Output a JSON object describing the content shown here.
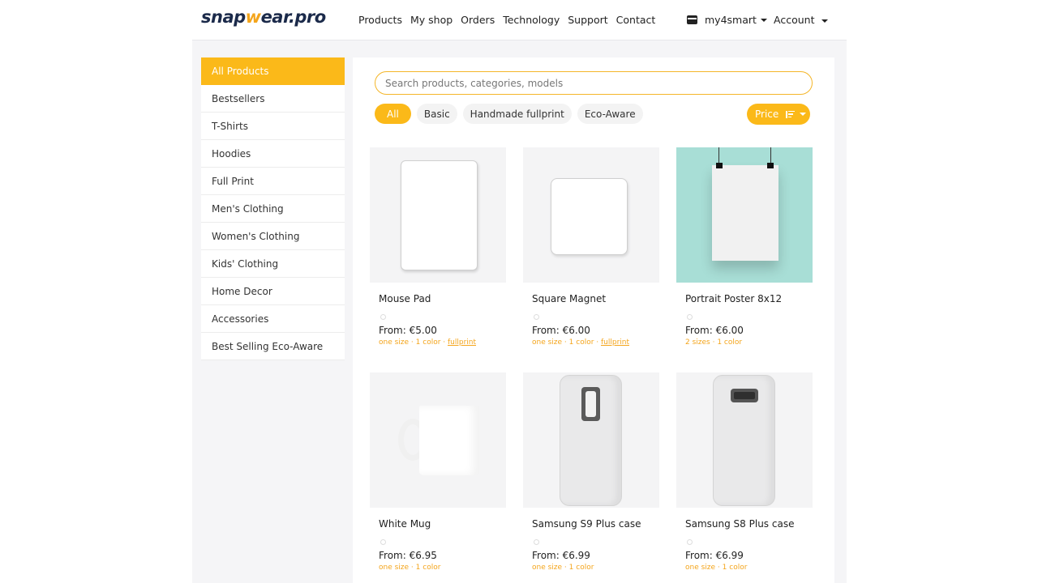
{
  "header": {
    "logo_prefix": "snap",
    "logo_accent": "w",
    "logo_suffix": "ear.pro",
    "nav": [
      "Products",
      "My shop",
      "Orders",
      "Technology",
      "Support",
      "Contact"
    ],
    "shop_name": "my4smart",
    "account_label": "Account"
  },
  "sidebar": {
    "items": [
      {
        "label": "All Products",
        "active": true
      },
      {
        "label": "Bestsellers"
      },
      {
        "label": "T-Shirts"
      },
      {
        "label": "Hoodies"
      },
      {
        "label": "Full Print"
      },
      {
        "label": "Men's Clothing"
      },
      {
        "label": "Women's Clothing"
      },
      {
        "label": "Kids' Clothing"
      },
      {
        "label": "Home Decor"
      },
      {
        "label": "Accessories"
      },
      {
        "label": "Best Selling Eco-Aware"
      }
    ]
  },
  "search": {
    "placeholder": "Search products, categories, models"
  },
  "filters": {
    "chips": [
      "All",
      "Basic",
      "Handmade fullprint",
      "Eco-Aware"
    ],
    "active_chip": "All",
    "sort_label": "Price"
  },
  "products": [
    {
      "name": "Mouse Pad",
      "price": "From: €5.00",
      "sizes": "one size",
      "colors": "1 color",
      "extra": "fullprint",
      "image": "mouse-pad"
    },
    {
      "name": "Square Magnet",
      "price": "From: €6.00",
      "sizes": "one size",
      "colors": "1 color",
      "extra": "fullprint",
      "image": "square-magnet"
    },
    {
      "name": "Portrait Poster 8x12",
      "price": "From: €6.00",
      "sizes": "2 sizes",
      "colors": "1 color",
      "extra": "",
      "image": "poster"
    },
    {
      "name": "White Mug",
      "price": "From: €6.95",
      "sizes": "one size",
      "colors": "1 color",
      "extra": "",
      "image": "mug"
    },
    {
      "name": "Samsung S9 Plus case",
      "price": "From: €6.99",
      "sizes": "one size",
      "colors": "1 color",
      "extra": "",
      "image": "phone-s9"
    },
    {
      "name": "Samsung S8 Plus case",
      "price": "From: €6.99",
      "sizes": "one size",
      "colors": "1 color",
      "extra": "",
      "image": "phone-s8"
    }
  ],
  "colors": {
    "accent": "#fbb919",
    "logo_dark": "#1b2a4a",
    "meta_text": "#f4a51c"
  }
}
